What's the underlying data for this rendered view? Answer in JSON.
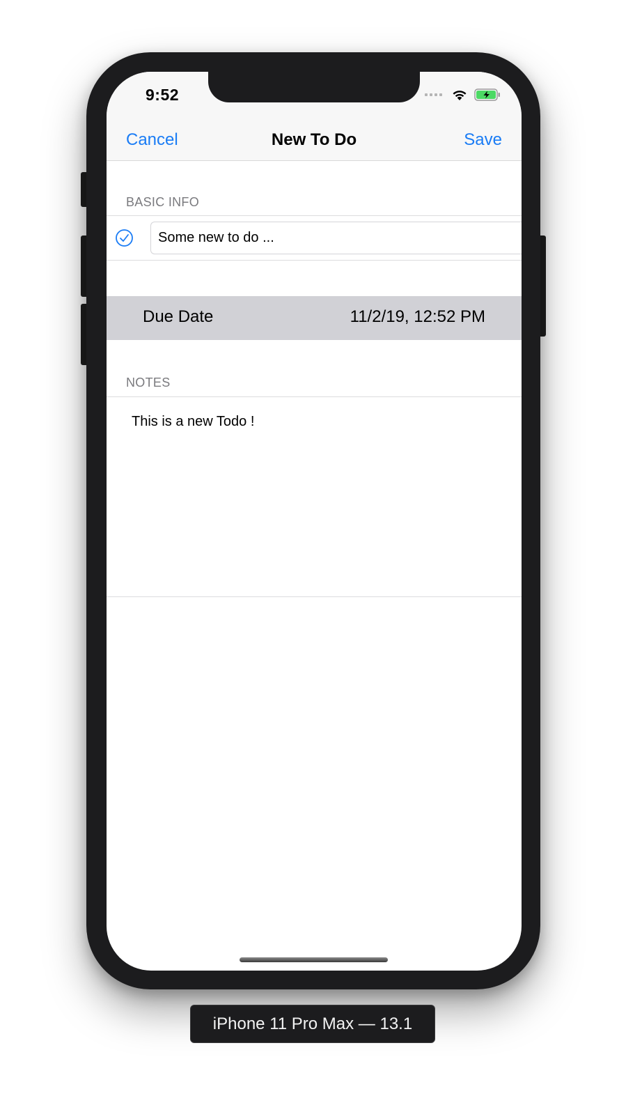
{
  "status_bar": {
    "time": "9:52",
    "icons": [
      "cellular-dots-icon",
      "wifi-icon",
      "battery-charging-icon"
    ]
  },
  "nav": {
    "cancel_label": "Cancel",
    "title": "New To Do",
    "save_label": "Save"
  },
  "basic_info": {
    "header": "BASIC INFO",
    "checkbox_icon": "checkmark-circle-icon",
    "title_value": "Some new to do ..."
  },
  "due_date": {
    "label": "Due Date",
    "value": "11/2/19, 12:52 PM"
  },
  "notes": {
    "header": "NOTES",
    "value": "This is a new Todo !"
  },
  "device": {
    "label": "iPhone 11 Pro Max — 13.1"
  },
  "colors": {
    "accent": "#1a7cf5",
    "due_row_background": "#d1d1d6",
    "section_header_text": "#7a7a7e",
    "battery_fill": "#4cd964"
  }
}
